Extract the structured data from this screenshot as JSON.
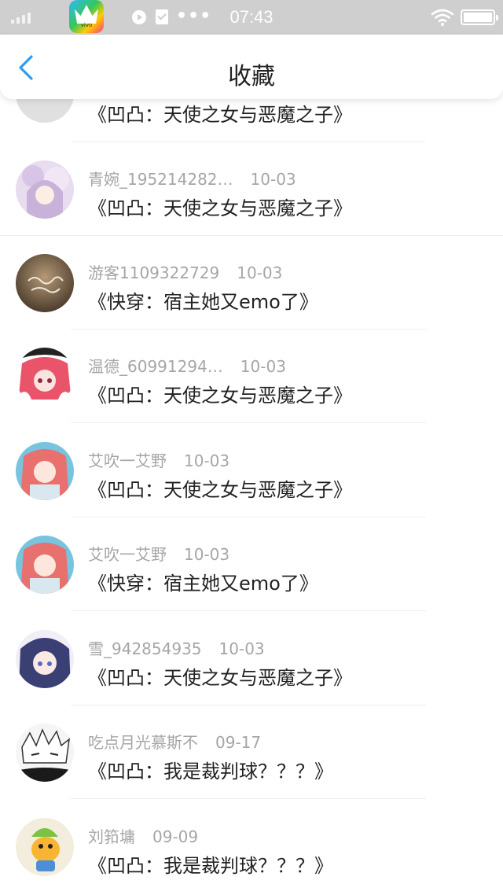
{
  "status_bar": {
    "time": "07:43",
    "app_icon_text": "vivo"
  },
  "header": {
    "title": "收藏",
    "back_icon": "chevron-left-icon",
    "accent_color": "#2f9bf2"
  },
  "favorites": [
    {
      "username": "",
      "date": "",
      "book": "《凹凸：天使之女与恶魔之子》",
      "avatar": "gray"
    },
    {
      "username": "青婉_195214282…",
      "date": "10-03",
      "book": "《凹凸：天使之女与恶魔之子》",
      "avatar": "lavender"
    },
    {
      "username": "游客1109322729",
      "date": "10-03",
      "book": "《快穿：宿主她又emo了》",
      "avatar": "sepia"
    },
    {
      "username": "温德_60991294…",
      "date": "10-03",
      "book": "《凹凸：天使之女与恶魔之子》",
      "avatar": "pink-dark"
    },
    {
      "username": "艾吹一艾野",
      "date": "10-03",
      "book": "《凹凸：天使之女与恶魔之子》",
      "avatar": "cyan-pink"
    },
    {
      "username": "艾吹一艾野",
      "date": "10-03",
      "book": "《快穿：宿主她又emo了》",
      "avatar": "cyan-pink"
    },
    {
      "username": "雪_942854935",
      "date": "10-03",
      "book": "《凹凸：天使之女与恶魔之子》",
      "avatar": "navy"
    },
    {
      "username": "吃点月光慕斯不",
      "date": "09-17",
      "book": "《凹凸：我是裁判球？？？》",
      "avatar": "sketch"
    },
    {
      "username": "刘筘墉",
      "date": "09-09",
      "book": "《凹凸：我是裁判球？？？》",
      "avatar": "cartoon"
    }
  ]
}
